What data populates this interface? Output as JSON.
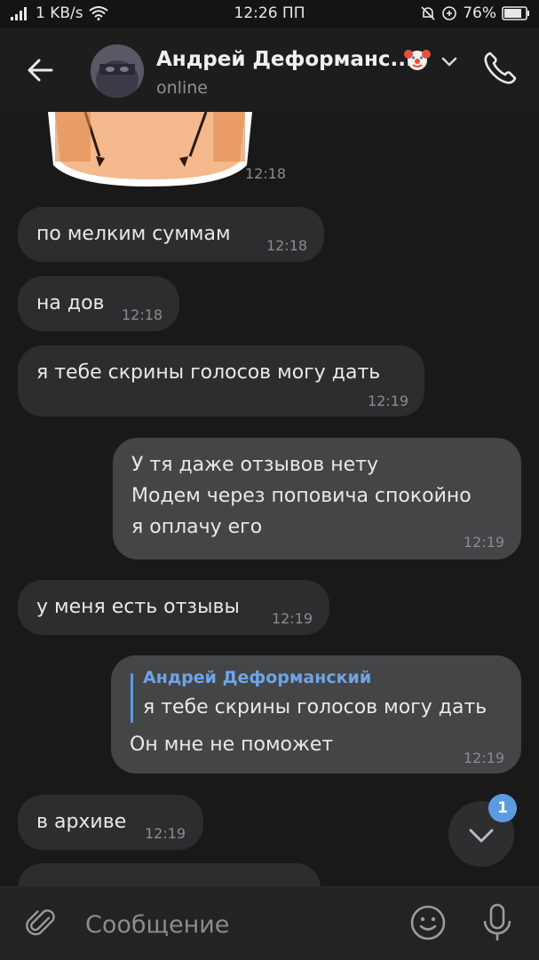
{
  "status_bar": {
    "network": "1 KB/s",
    "time": "12:26 ПП",
    "battery": "76%"
  },
  "header": {
    "title": "Андрей Деформанс...",
    "status": "online",
    "avatar_icon": "avatar-image",
    "title_emoji_icon": "clown-face-icon"
  },
  "messages": [
    {
      "type": "sticker",
      "time": "12:18"
    },
    {
      "direction": "in",
      "text": "по мелким суммам",
      "time": "12:18"
    },
    {
      "direction": "in",
      "text": "на дов",
      "time": "12:18"
    },
    {
      "direction": "in",
      "text": "я тебе скрины голосов могу дать",
      "time": "12:19"
    },
    {
      "direction": "out",
      "lines": [
        "У тя даже отзывов нету",
        "Модем через поповича спокойно",
        "я оплачу его"
      ],
      "time": "12:19"
    },
    {
      "direction": "in",
      "text": "у меня есть отзывы",
      "time": "12:19"
    },
    {
      "direction": "out",
      "reply_to": {
        "name": "Андрей Деформанский",
        "text": "я тебе скрины голосов могу дать"
      },
      "text": "Он мне не поможет",
      "time": "12:19"
    },
    {
      "direction": "in",
      "text": "в архиве",
      "time": "12:19"
    }
  ],
  "scroll_down": {
    "unread_count": "1"
  },
  "composer": {
    "placeholder": "Сообщение"
  },
  "colors": {
    "incoming": "#2c2d2e",
    "outgoing": "#444547",
    "accent": "#5d9be0",
    "background": "#19191a"
  }
}
